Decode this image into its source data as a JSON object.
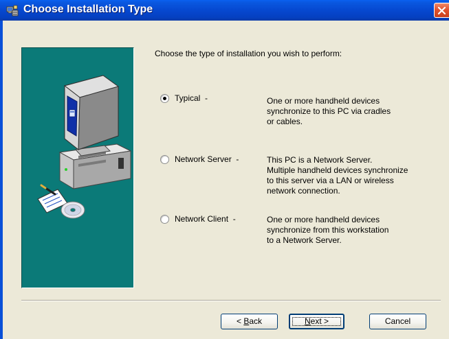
{
  "window": {
    "title": "Choose Installation Type",
    "title_icon": "installer-icon",
    "close_icon": "close-icon"
  },
  "banner": {
    "icon": "computer-with-cd-icon",
    "background": "#0b7a78"
  },
  "content": {
    "heading": "Choose the type of installation you wish to perform:",
    "options": [
      {
        "label": "Typical",
        "dash": "-",
        "selected": true,
        "description": [
          "One or more handheld devices",
          "synchronize to this PC via cradles",
          "or cables."
        ]
      },
      {
        "label": "Network Server",
        "dash": "-",
        "selected": false,
        "description": [
          "This PC is a Network Server.",
          "Multiple handheld devices synchronize",
          "to this server via a LAN or wireless",
          "network connection."
        ]
      },
      {
        "label": "Network Client",
        "dash": "-",
        "selected": false,
        "description": [
          "One or more handheld devices",
          "synchronize from this workstation",
          "to a Network Server."
        ]
      }
    ]
  },
  "buttons": {
    "back": {
      "prefix": "< ",
      "mnemonic": "B",
      "rest": "ack"
    },
    "next": {
      "mnemonic": "N",
      "rest": "ext >"
    },
    "cancel": "Cancel"
  },
  "colors": {
    "titlebar": "#0a50d8",
    "dialog_bg": "#ece9d8",
    "close_button": "#e2532f"
  }
}
